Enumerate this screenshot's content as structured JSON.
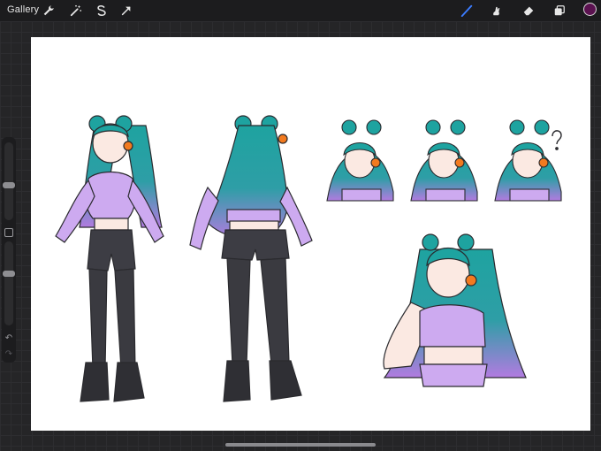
{
  "topbar": {
    "gallery_label": "Gallery",
    "left_tools": [
      {
        "icon": "wrench-icon"
      },
      {
        "icon": "magic-wand-icon"
      },
      {
        "icon": "selection-icon"
      },
      {
        "icon": "transform-arrow-icon"
      }
    ],
    "right_tools": [
      {
        "icon": "brush-icon",
        "active": true
      },
      {
        "icon": "smudge-icon"
      },
      {
        "icon": "eraser-icon"
      },
      {
        "icon": "layers-icon"
      }
    ],
    "current_color": "#5b1250"
  },
  "sidebar": {
    "brush_size_level": 0.45,
    "opacity_level": 0.62,
    "undo_icon": "undo-icon",
    "redo_icon": "redo-icon"
  },
  "canvas": {
    "background": "#ffffff",
    "artwork": "character-reference-sheet",
    "palette": {
      "hair_teal": "#1ea3a0",
      "hair_purple": "#b27be0",
      "top_lilac": "#cdaaf0",
      "shorts": "#3d3d44",
      "stockings": "#3a3a40",
      "skin": "#fbe9e2",
      "orange_headphones": "#f27a1f",
      "outline": "#2a2a2e"
    }
  },
  "accent": "#3b7cff"
}
